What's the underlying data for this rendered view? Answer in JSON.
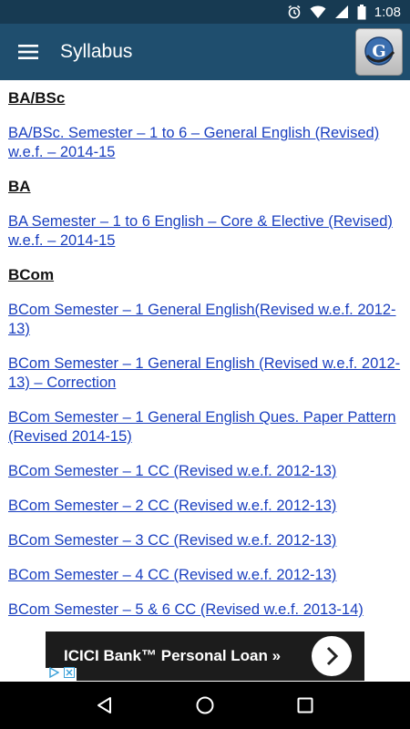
{
  "status_bar": {
    "time": "1:08",
    "icons": [
      "alarm-icon",
      "wifi-icon",
      "signal-icon",
      "battery-icon"
    ]
  },
  "app_bar": {
    "title": "Syllabus",
    "menu_icon": "hamburger-menu-icon",
    "logo_icon": "app-logo-icon",
    "color": "#1f4e6e"
  },
  "sections": [
    {
      "heading": "BA/BSc",
      "links": [
        "BA/BSc. Semester – 1 to 6 – General English  (Revised) w.e.f. – 2014-15"
      ]
    },
    {
      "heading": "BA",
      "links": [
        "BA Semester – 1 to 6 English – Core & Elective (Revised) w.e.f. – 2014-15"
      ]
    },
    {
      "heading": "BCom",
      "links": [
        "BCom Semester – 1 General English(Revised w.e.f. 2012-13)",
        "BCom Semester – 1 General English (Revised w.e.f. 2012-13) – Correction",
        "BCom Semester – 1 General English Ques. Paper Pattern (Revised 2014-15)",
        "BCom Semester – 1 CC (Revised w.e.f. 2012-13)",
        "BCom Semester – 2 CC (Revised w.e.f. 2012-13)",
        "BCom Semester – 3 CC (Revised w.e.f. 2012-13)",
        "BCom Semester – 4 CC (Revised w.e.f. 2012-13)",
        "BCom Semester – 5 & 6 CC (Revised w.e.f. 2013-14)"
      ]
    }
  ],
  "ad": {
    "text": "ICICI Bank™ Personal Loan »",
    "arrow_icon": "chevron-right-icon"
  },
  "nav_bar": {
    "icons": [
      "back-icon",
      "home-icon",
      "recents-icon"
    ]
  },
  "colors": {
    "link": "#1a3fbf",
    "status_bar": "#173a52"
  }
}
